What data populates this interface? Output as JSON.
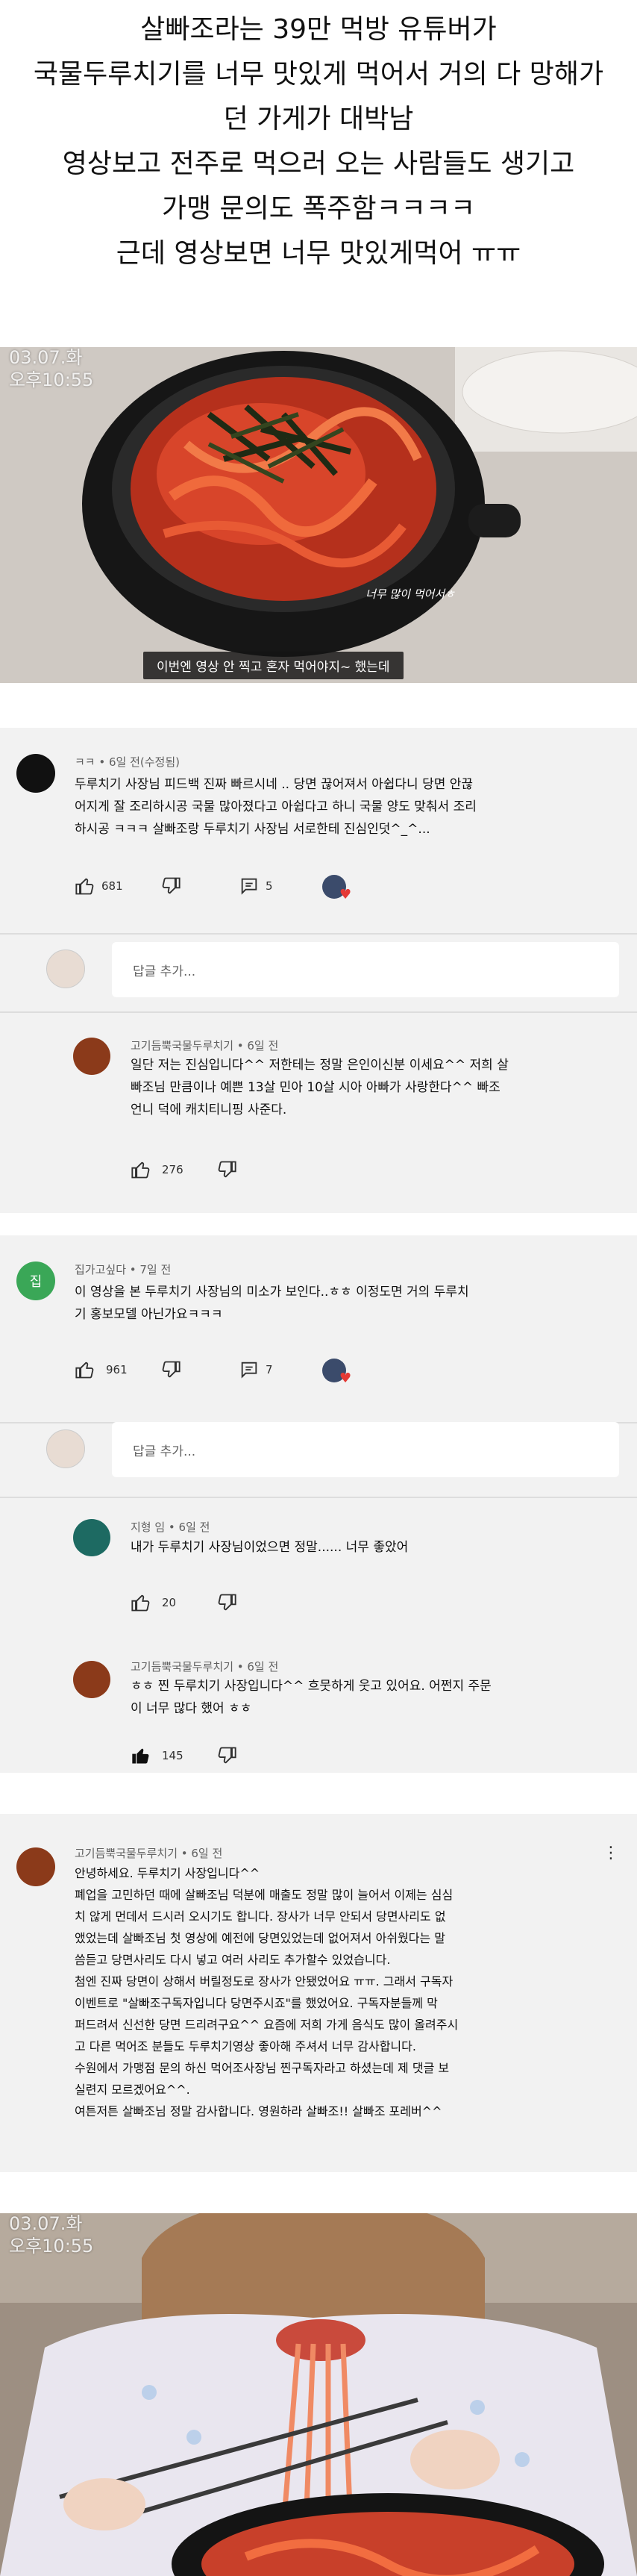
{
  "headline": [
    "살빠조라는 39만 먹방 유튜버가",
    "국물두루치기를 너무 맛있게 먹어서 거의 다 망해가",
    "던 가게가 대박남",
    "영상보고 전주로 먹으러 오는 사람들도 생기고",
    "가맹 문의도 폭주함ㅋㅋㅋㅋ",
    "근데 영상보면 너무 맛있게먹어 ㅠㅠ"
  ],
  "video1": {
    "date": "03.07.화",
    "time": "오후10:55",
    "inline_caption": "너무 많이 먹어서ㅎ",
    "caption": "이번엔 영상 안 찍고 혼자 먹어야지~ 했는데"
  },
  "video2": {
    "date": "03.07.화",
    "time": "오후10:55"
  },
  "colors": {
    "like_red": "#e53935",
    "avatar_green": "#3aa757",
    "avatar_teal": "#1d6a62"
  },
  "comment1": {
    "author_meta": "ㅋㅋ • 6일 전(수정됨)",
    "lines": [
      "두루치기 사장님 피드백 진짜 빠르시네 .. 당면 끊어져서 아쉽다니 당면 안끊",
      "어지게 잘 조리하시공 국물 많아졌다고 아쉽다고 하니 국물 양도 맞춰서 조리",
      "하시공 ㅋㅋㅋ 살빠조랑 두루치기 사장님 서로한테 진심인덧^_^..."
    ],
    "likes": "681",
    "replies": "5"
  },
  "reply_box1": {
    "placeholder": "답글 추가..."
  },
  "reply1": {
    "author_meta": "고기듬뿍국물두루치기 • 6일 전",
    "lines": [
      "일단 저는 진심입니다^^ 저한테는 정말 은인이신분 이세요^^ 저희 살",
      "빠조님 만큼이나 예쁜 13살 민아 10살 시아 아빠가 사랑한다^^ 빠조",
      "언니 덕에 캐치티니핑 사준다."
    ],
    "likes": "276"
  },
  "comment2": {
    "avatar_letter": "집",
    "author_meta": "집가고싶다 • 7일 전",
    "lines": [
      "이 영상을 본 두루치기 사장님의 미소가 보인다..ㅎㅎ 이정도면 거의 두루치",
      "기 홍보모델 아닌가요ㅋㅋㅋ"
    ],
    "likes": "961",
    "replies": "7"
  },
  "reply_box2": {
    "placeholder": "답글 추가..."
  },
  "reply2": {
    "author_meta": "지형 임 • 6일 전",
    "lines": [
      "내가 두루치기 사장님이었으면 정말...... 너무 좋았어"
    ],
    "likes": "20"
  },
  "reply3": {
    "author_meta": "고기듬뿍국물두루치기 • 6일 전",
    "lines": [
      "ㅎㅎ 찐 두루치기 사장입니다^^ 흐뭇하게 웃고 있어요. 어쩐지 주문",
      "이 너무 많다 했어 ㅎㅎ"
    ],
    "likes": "145"
  },
  "comment3": {
    "author_meta": "고기듬뿍국물두루치기 • 6일 전",
    "lines": [
      "안녕하세요. 두루치기 사장입니다^^",
      "폐업을 고민하던 때에 살빠조님 덕분에 매출도 정말 많이 늘어서 이제는 심심",
      "치 않게 먼데서 드시러 오시기도 합니다. 장사가 너무 안되서 당면사리도 없",
      "앴었는데 살빠조님 첫 영상에 예전에 당면있었는데 없어져서 아쉬웠다는 말",
      "씀듣고 당면사리도 다시 넣고 여러 사리도 추가할수 있었습니다.",
      "첨엔 진짜 당면이 상해서 버릴정도로 장사가 안됐었어요 ㅠㅠ. 그래서 구독자",
      "이벤트로 \"살빠조구독자입니다 당면주시죠\"를 했었어요. 구독자분들께 막",
      "퍼드려서 신선한 당면 드리려구요^^ 요즘에 저희 가게 음식도 많이 올려주시",
      "고 다른 먹어조 분들도 두루치기영상 좋아해 주셔서 너무 감사합니다.",
      "수원에서 가맹점 문의 하신 먹어조사장님 찐구독자라고 하셨는데 제 댓글 보",
      "실련지 모르겠어요^^.",
      "여튼저튼 살빠조님 정말 감사합니다. 영원하라 살빠조!! 살빠조 포레버^^"
    ]
  }
}
